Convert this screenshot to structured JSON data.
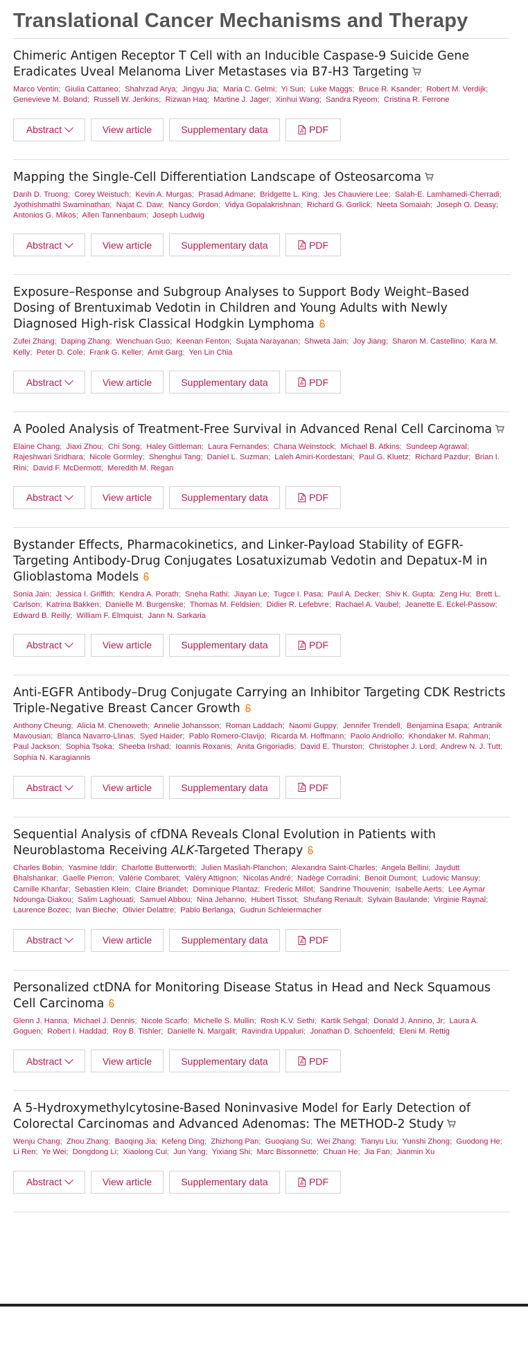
{
  "section_title": "Translational Cancer Mechanisms and Therapy",
  "button_labels": {
    "abstract": "Abstract",
    "view_article": "View article",
    "supplementary": "Supplementary data",
    "pdf": "PDF"
  },
  "colors": {
    "link": "#b01e4f",
    "open_access": "#f0882a",
    "cart_icon": "#555555"
  },
  "articles": [
    {
      "title_parts": [
        "Chimeric Antigen Receptor T Cell with an Inducible Caspase-9 Suicide Gene Eradicates Uveal Melanoma Liver Metastases via B7-H3 Targeting"
      ],
      "access_icon": "cart-icon",
      "authors": [
        "Marco Ventin",
        "Giulia Cattaneo",
        "Shahrzad Arya",
        "Jingyu Jia",
        "Maria C. Gelmi",
        "Yi Sun",
        "Luke Maggs",
        "Bruce R. Ksander",
        "Robert M. Verdijk",
        "Genevieve M. Boland",
        "Russell W. Jenkins",
        "Rizwan Haq",
        "Martine J. Jager",
        "Xinhui Wang",
        "Sandra Ryeom",
        "Cristina R. Ferrone"
      ]
    },
    {
      "title_parts": [
        "Mapping the Single-Cell Differentiation Landscape of Osteosarcoma"
      ],
      "access_icon": "cart-icon",
      "authors": [
        "Danh D. Truong",
        "Corey Weistuch",
        "Kevin A. Murgas",
        "Prasad Admane",
        "Bridgette L. King",
        "Jes Chauviere Lee",
        "Salah-E. Lamhamedi-Cherradi",
        "Jyothishmathi Swaminathan",
        "Najat C. Daw",
        "Nancy Gordon",
        "Vidya Gopalakrishnan",
        "Richard G. Gorlick",
        "Neeta Somaiah",
        "Joseph O. Deasy",
        "Antonios G. Mikos",
        "Allen Tannenbaum",
        "Joseph Ludwig"
      ]
    },
    {
      "title_parts": [
        "Exposure–Response and Subgroup Analyses to Support Body Weight–Based Dosing of Brentuximab Vedotin in Children and Young Adults with Newly Diagnosed High-risk Classical Hodgkin Lymphoma"
      ],
      "access_icon": "open-access-icon",
      "authors": [
        "Zufei Zhang",
        "Daping Zhang",
        "Wenchuan Guo",
        "Keenan Fenton",
        "Sujata Narayanan",
        "Shweta Jain",
        "Joy Jiang",
        "Sharon M. Castellino",
        "Kara M. Kelly",
        "Peter D. Cole",
        "Frank G. Keller",
        "Amit Garg",
        "Yen Lin Chia"
      ]
    },
    {
      "title_parts": [
        "A Pooled Analysis of Treatment-Free Survival in Advanced Renal Cell Carcinoma"
      ],
      "access_icon": "cart-icon",
      "authors": [
        "Elaine Chang",
        "Jiaxi Zhou",
        "Chi Song",
        "Haley Gittleman",
        "Laura Fernandes",
        "Chana Weinstock",
        "Michael B. Atkins",
        "Sundeep Agrawal",
        "Rajeshwari Sridhara",
        "Nicole Gormley",
        "Shenghui Tang",
        "Daniel L. Suzman",
        "Laleh Amiri-Kordestani",
        "Paul G. Kluetz",
        "Richard Pazdur",
        "Brian I. Rini",
        "David F. McDermott",
        "Meredith M. Regan"
      ]
    },
    {
      "title_parts": [
        "Bystander Effects, Pharmacokinetics, and Linker-Payload Stability of EGFR-Targeting Antibody-Drug Conjugates Losatuxizumab Vedotin and Depatux-M in Glioblastoma Models"
      ],
      "access_icon": "open-access-icon",
      "authors": [
        "Sonia Jain",
        "Jessica I. Griffith",
        "Kendra A. Porath",
        "Sneha Rathi",
        "Jiayan Le",
        "Tugce I. Pasa",
        "Paul A. Decker",
        "Shiv K. Gupta",
        "Zeng Hu",
        "Brett L. Carlson",
        "Katrina Bakken",
        "Danielle M. Burgenske",
        "Thomas M. Feldsien",
        "Didier R. Lefebvre",
        "Rachael A. Vaubel",
        "Jeanette E. Eckel-Passow",
        "Edward B. Reilly",
        "William F. Elmquist",
        "Jann N. Sarkaria"
      ]
    },
    {
      "title_parts": [
        "Anti-EGFR Antibody–Drug Conjugate Carrying an Inhibitor Targeting CDK Restricts Triple-Negative Breast Cancer Growth"
      ],
      "access_icon": "open-access-icon",
      "authors": [
        "Anthony Cheung",
        "Alicia M. Chenoweth",
        "Annelie Johansson",
        "Roman Laddach",
        "Naomi Guppy",
        "Jennifer Trendell",
        "Benjamina Esapa",
        "Antranik Mavousian",
        "Blanca Navarro-Llinas",
        "Syed Haider",
        "Pablo Romero-Clavijo",
        "Ricarda M. Hoffmann",
        "Paolo Andriollo",
        "Khondaker M. Rahman",
        "Paul Jackson",
        "Sophia Tsoka",
        "Sheeba Irshad",
        "Ioannis Roxanis",
        "Anita Grigoriadis",
        "David E. Thurston",
        "Christopher J. Lord",
        "Andrew N. J. Tutt",
        "Sophia N. Karagiannis"
      ]
    },
    {
      "title_parts": [
        "Sequential Analysis of cfDNA Reveals Clonal Evolution in Patients with Neuroblastoma Receiving ",
        "ALK",
        "-Targeted Therapy"
      ],
      "access_icon": "open-access-icon",
      "authors": [
        "Charles Bobin",
        "Yasmine Iddir",
        "Charlotte Butterworth",
        "Julien Masliah-Planchon",
        "Alexandra Saint-Charles",
        "Angela Bellini",
        "Jaydutt Bhalshankar",
        "Gaelle Pierron",
        "Valérie Combaret",
        "Valéry Attignon",
        "Nicolas André",
        "Nadège Corradini",
        "Benoit Dumont",
        "Ludovic Mansuy",
        "Camille Khanfar",
        "Sebastien Klein",
        "Claire Briandet",
        "Dominique Plantaz",
        "Frederic Millot",
        "Sandrine Thouvenin",
        "Isabelle Aerts",
        "Lee Aymar Ndounga-Diakou",
        "Salim Laghouati",
        "Samuel Abbou",
        "Nina Jehanno",
        "Hubert Tissot",
        "Shufang Renault",
        "Sylvain Baulande",
        "Virginie Raynal",
        "Laurence Bozec",
        "Ivan Bieche",
        "Olivier Delattre",
        "Pablo Berlanga",
        "Gudrun Schleiermacher"
      ]
    },
    {
      "title_parts": [
        "Personalized ctDNA for Monitoring Disease Status in Head and Neck Squamous Cell Carcinoma"
      ],
      "access_icon": "open-access-icon",
      "authors": [
        "Glenn J. Hanna",
        "Michael J. Dennis",
        "Nicole Scarfo",
        "Michelle S. Mullin",
        "Rosh K.V. Sethi",
        "Kartik Sehgal",
        "Donald J. Annino, Jr",
        "Laura A. Goguen",
        "Robert I. Haddad",
        "Roy B. Tishler",
        "Danielle N. Margalit",
        "Ravindra Uppaluri",
        "Jonathan D. Schoenfeld",
        "Eleni M. Rettig"
      ]
    },
    {
      "title_parts": [
        "A 5-Hydroxymethylcytosine-Based Noninvasive Model for Early Detection of Colorectal Carcinomas and Advanced Adenomas: The METHOD-2 Study"
      ],
      "access_icon": "cart-icon",
      "authors": [
        "Wenju Chang",
        "Zhou Zhang",
        "Baoqing Jia",
        "Kefeng Ding",
        "Zhizhong Pan",
        "Guoqiang Su",
        "Wei Zhang",
        "Tianyu Liu",
        "Yunshi Zhong",
        "Guodong He",
        "Li Ren",
        "Ye Wei",
        "Dongdong Li",
        "Xiaolong Cui",
        "Jun Yang",
        "Yixiang Shi",
        "Marc Bissonnette",
        "Chuan He",
        "Jia Fan",
        "Jianmin Xu"
      ]
    }
  ]
}
